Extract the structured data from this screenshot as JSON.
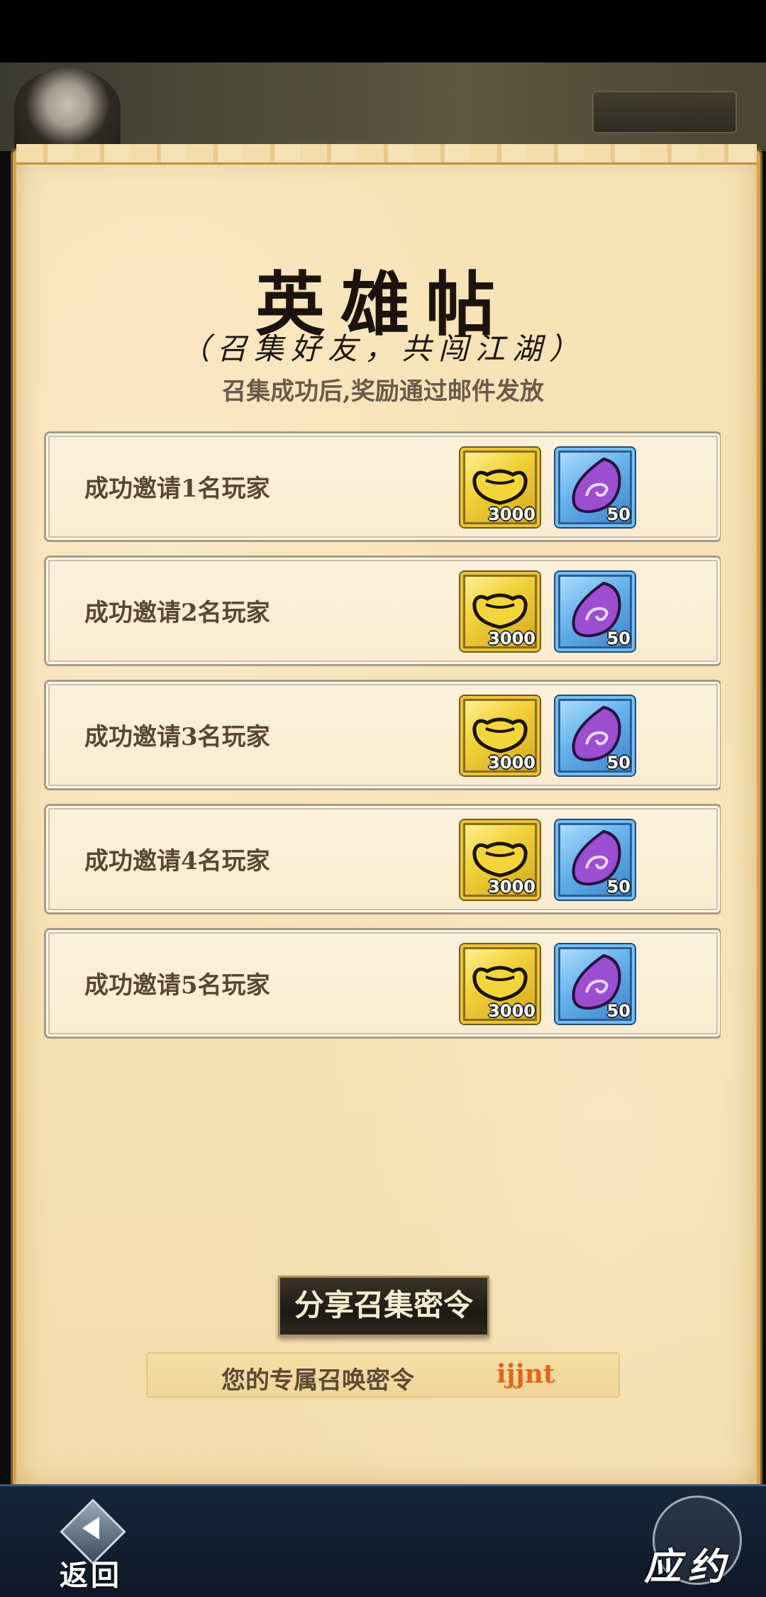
{
  "header": {
    "title": "英雄帖",
    "subtitle": "（召集好友，共闯江湖）",
    "note": "召集成功后,奖励通过邮件发放"
  },
  "rewards": [
    {
      "label": "成功邀请1名玩家",
      "gold_qty": "3000",
      "stone_qty": "50"
    },
    {
      "label": "成功邀请2名玩家",
      "gold_qty": "3000",
      "stone_qty": "50"
    },
    {
      "label": "成功邀请3名玩家",
      "gold_qty": "3000",
      "stone_qty": "50"
    },
    {
      "label": "成功邀请4名玩家",
      "gold_qty": "3000",
      "stone_qty": "50"
    },
    {
      "label": "成功邀请5名玩家",
      "gold_qty": "3000",
      "stone_qty": "50"
    }
  ],
  "icons": {
    "gold": "gold-ingot-icon",
    "stone": "purple-stone-icon"
  },
  "share_button": {
    "label": "分享召集密令"
  },
  "code": {
    "label": "您的专属召唤密令",
    "value": "ijjnt"
  },
  "bottom": {
    "back_label": "返回",
    "yingyue_label": "应约"
  },
  "colors": {
    "code_value": "#e1661c",
    "scroll_border": "#d8a24a"
  }
}
